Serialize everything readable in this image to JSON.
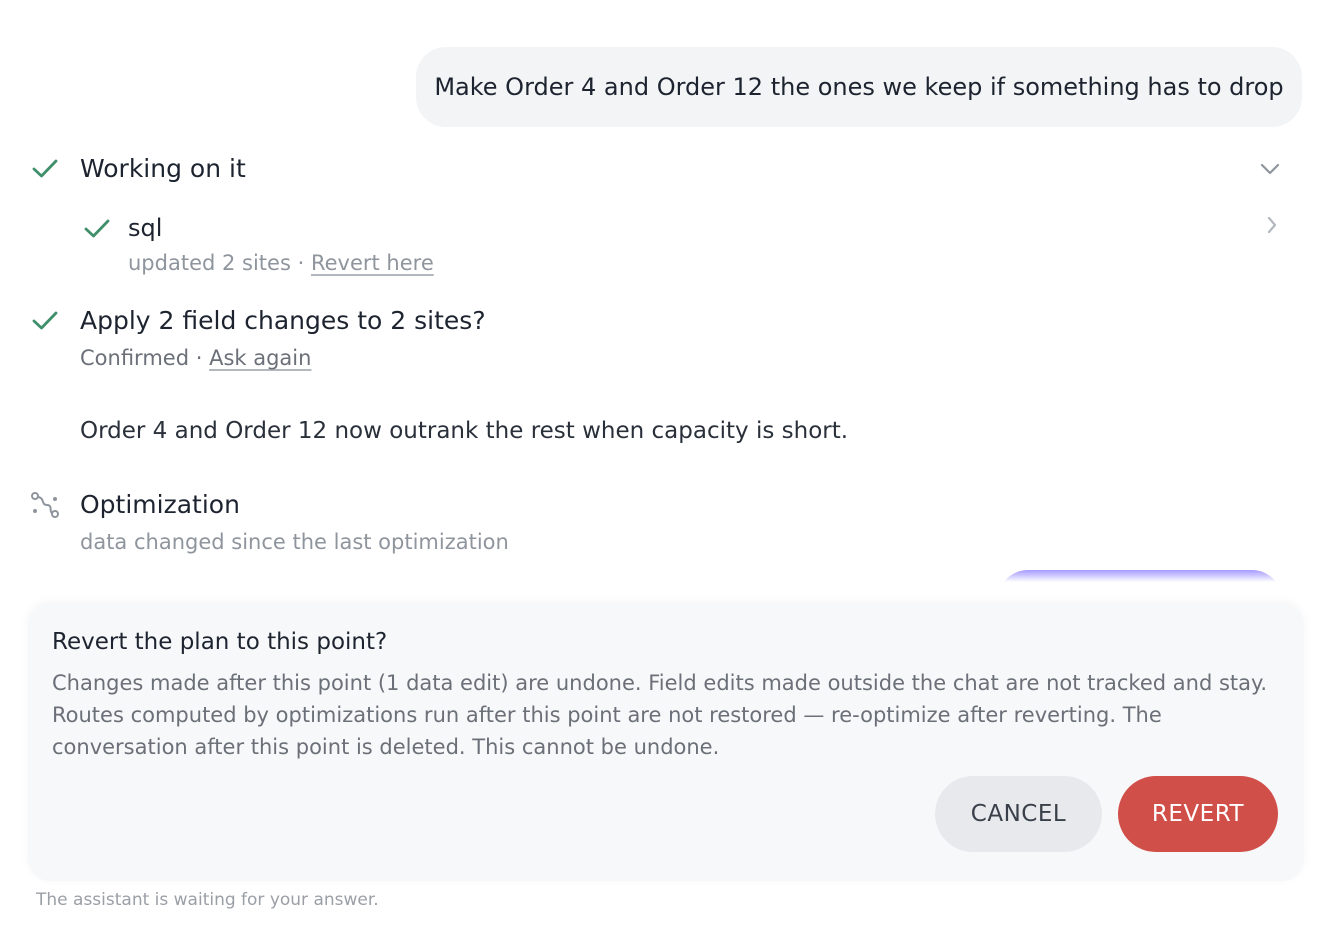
{
  "user_message": "Make Order 4 and Order 12 the ones we keep if something has to drop",
  "working": {
    "title": "Working on it",
    "step": {
      "name": "sql",
      "summary": "updated 2 sites",
      "separator": "·",
      "revert_link": "Revert here"
    }
  },
  "confirmation": {
    "title": "Apply 2 field changes to 2 sites?",
    "status": "Confirmed",
    "separator": "·",
    "ask_again_link": "Ask again"
  },
  "result_text": "Order 4 and Order 12 now outrank the rest when capacity is short.",
  "optimization": {
    "title": "Optimization",
    "subtitle": "data changed since the last optimization"
  },
  "dialog": {
    "title": "Revert the plan to this point?",
    "body": "Changes made after this point (1 data edit) are undone. Field edits made outside the chat are not tracked and stay. Routes computed by optimizations run after this point are not restored — re-optimize after reverting. The conversation after this point is deleted. This cannot be undone.",
    "cancel_label": "CANCEL",
    "revert_label": "REVERT"
  },
  "footer_note": "The assistant is waiting for your answer.",
  "colors": {
    "check_green": "#3f8f6b",
    "revert_red": "#d14f49",
    "accent_purple": "#a79bff"
  },
  "icons": [
    "check-icon",
    "chevron-down-icon",
    "chevron-right-icon",
    "optimization-route-icon"
  ]
}
